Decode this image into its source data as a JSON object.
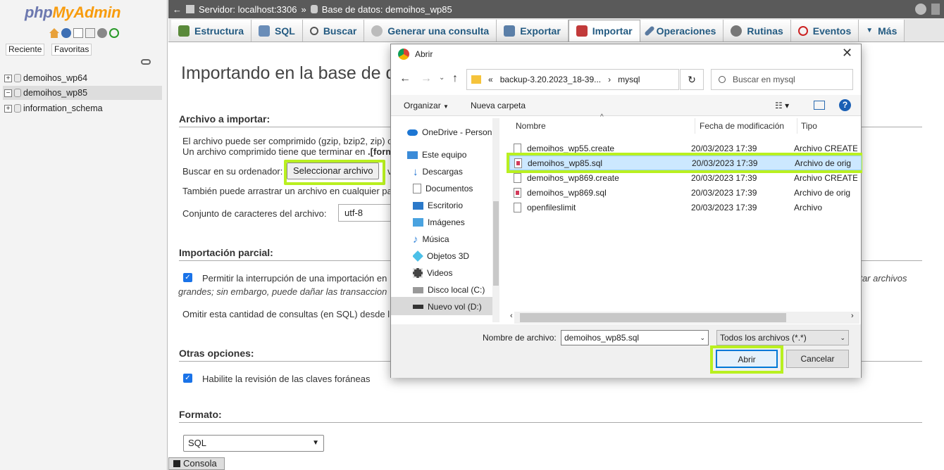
{
  "sidebar": {
    "logo_part1": "php",
    "logo_part2": "MyAdmin",
    "recent_label": "Reciente",
    "favorites_label": "Favoritas",
    "databases": [
      "demoihos_wp64",
      "demoihos_wp85",
      "information_schema"
    ]
  },
  "topbar": {
    "server": "Servidor: localhost:3306",
    "sep": "»",
    "database": "Base de datos: demoihos_wp85"
  },
  "tabs": [
    "Estructura",
    "SQL",
    "Buscar",
    "Generar una consulta",
    "Exportar",
    "Importar",
    "Operaciones",
    "Rutinas",
    "Eventos",
    "Más"
  ],
  "main": {
    "title": "Importando en la base de datos",
    "file_section": "Archivo a importar:",
    "compress_line1": "El archivo puede ser comprimido (gzip, bzip2, zip) o",
    "compress_line2": "Un archivo comprimido tiene que terminar en",
    "compress_ext": ".[form",
    "browse_label": "Buscar en su ordenador:",
    "browse_button": "Seleccionar archivo",
    "browse_suffix": "v",
    "drag_text": "También puede arrastrar un archivo en cualquier pa",
    "charset_label": "Conjunto de caracteres del archivo:",
    "charset_value": "utf-8",
    "partial_section": "Importación parcial:",
    "partial_check_text": "Permitir la interrupción de una importación en",
    "partial_check_right": "rtar archivos",
    "partial_line2": "grandes; sin embargo, puede dañar las transaccion",
    "skip_text": "Omitir esta cantidad de consultas (en SQL) desde l",
    "other_section": "Otras opciones:",
    "fk_text": "Habilite la revisión de las claves foráneas",
    "format_section": "Formato:",
    "format_value": "SQL"
  },
  "console_label": "Consola",
  "dialog": {
    "title": "Abrir",
    "path_prefix": "«",
    "path_folder": "backup-3.20.2023_18-39...",
    "path_arrow": "›",
    "path_sub": "mysql",
    "search_placeholder": "Buscar en mysql",
    "organize": "Organizar",
    "new_folder": "Nueva carpeta",
    "nav_items": [
      "OneDrive - Person",
      "Este equipo",
      "Descargas",
      "Documentos",
      "Escritorio",
      "Imágenes",
      "Música",
      "Objetos 3D",
      "Videos",
      "Disco local (C:)",
      "Nuevo vol (D:)"
    ],
    "columns": {
      "name": "Nombre",
      "date": "Fecha de modificación",
      "type": "Tipo"
    },
    "files": [
      {
        "name": "demoihos_wp55.create",
        "date": "20/03/2023 17:39",
        "type": "Archivo CREATE"
      },
      {
        "name": "demoihos_wp85.sql",
        "date": "20/03/2023 17:39",
        "type": "Archivo de orig"
      },
      {
        "name": "demoihos_wp869.create",
        "date": "20/03/2023 17:39",
        "type": "Archivo CREATE"
      },
      {
        "name": "demoihos_wp869.sql",
        "date": "20/03/2023 17:39",
        "type": "Archivo de orig"
      },
      {
        "name": "openfileslimit",
        "date": "20/03/2023 17:39",
        "type": "Archivo"
      }
    ],
    "filename_label": "Nombre de archivo:",
    "filename_value": "demoihos_wp85.sql",
    "filter_value": "Todos los archivos (*.*)",
    "open_button": "Abrir",
    "cancel_button": "Cancelar"
  },
  "colors": {
    "highlight": "#b9f020",
    "selected_row": "#cce8ff",
    "accent": "#235a81"
  }
}
